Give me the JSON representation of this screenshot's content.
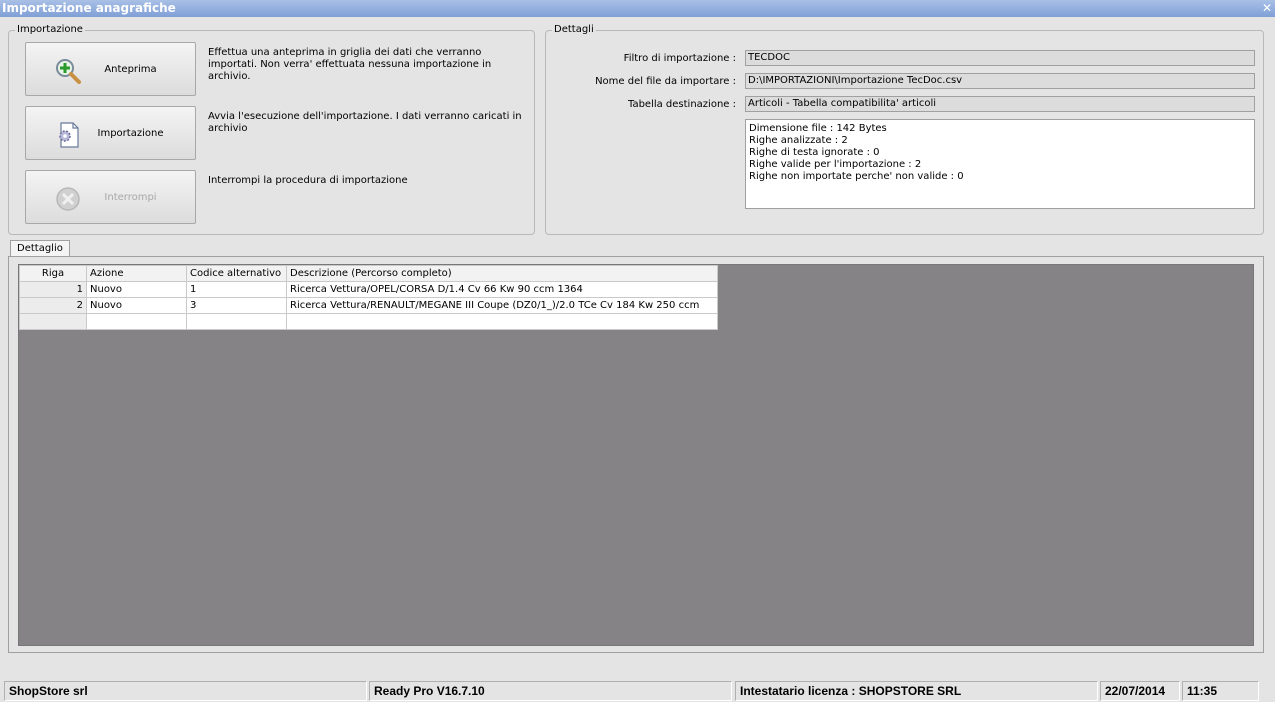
{
  "window": {
    "title": "Importazione anagrafiche",
    "close_glyph": "✕"
  },
  "import_group": {
    "legend": "Importazione",
    "buttons": [
      {
        "label": "Anteprima",
        "icon": "magnifier-plus-icon",
        "description": "Effettua una anteprima in griglia dei dati che verranno importati. Non verra' effettuata nessuna importazione in archivio.",
        "enabled": true
      },
      {
        "label": "Importazione",
        "icon": "document-gear-icon",
        "description": "Avvia l'esecuzione dell'importazione. I dati verranno caricati in archivio",
        "enabled": true
      },
      {
        "label": "Interrompi",
        "icon": "stop-icon",
        "description": "Interrompi la procedura di importazione",
        "enabled": false
      }
    ]
  },
  "details_group": {
    "legend": "Dettagli",
    "fields": [
      {
        "label": "Filtro di importazione :",
        "value": "TECDOC"
      },
      {
        "label": "Nome del file da importare :",
        "value": "D:\\IMPORTAZIONI\\Importazione TecDoc.csv"
      },
      {
        "label": "Tabella destinazione :",
        "value": "Articoli - Tabella compatibilita' articoli"
      }
    ],
    "summary": [
      "Dimensione file : 142 Bytes",
      "Righe analizzate : 2",
      "Righe di testa ignorate : 0",
      "Righe valide per l'importazione : 2",
      "Righe non importate perche' non valide : 0"
    ]
  },
  "tab": {
    "label": "Dettaglio"
  },
  "grid": {
    "columns": [
      "Riga",
      "Azione",
      "Codice alternativo",
      "Descrizione (Percorso completo)"
    ],
    "rows": [
      [
        "1",
        "Nuovo",
        "1",
        "Ricerca Vettura/OPEL/CORSA D/1.4 Cv 66 Kw 90 ccm 1364"
      ],
      [
        "2",
        "Nuovo",
        "3",
        "Ricerca Vettura/RENAULT/MEGANE III Coupe (DZ0/1_)/2.0 TCe  Cv 184 Kw 250 ccm"
      ],
      [
        "",
        "",
        "",
        ""
      ]
    ]
  },
  "statusbar": {
    "company": "ShopStore srl",
    "version": "Ready Pro V16.7.10",
    "license": "Intestatario licenza : SHOPSTORE SRL",
    "date": "22/07/2014",
    "time": "11:35"
  },
  "colors": {
    "title_bar": "#7f9fd6",
    "grid_background": "#868386",
    "panel": "#e4e4e4"
  }
}
